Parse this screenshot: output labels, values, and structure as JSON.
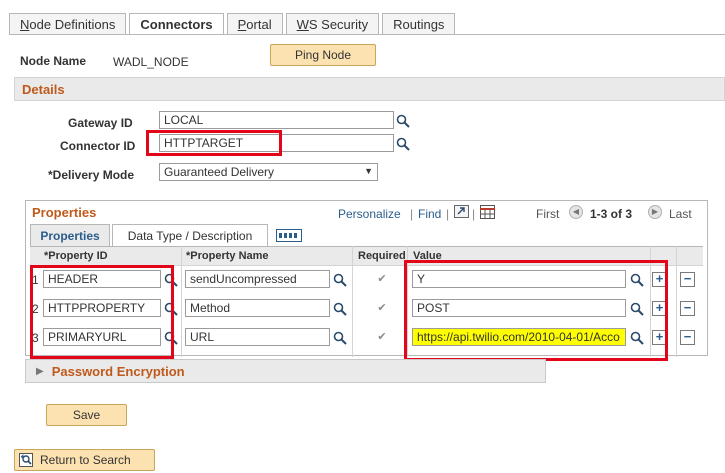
{
  "tabs": [
    {
      "label": "Node Definitions",
      "active": false
    },
    {
      "label": "Connectors",
      "active": true
    },
    {
      "label": "Portal",
      "active": false
    },
    {
      "label": "WS Security",
      "active": false
    },
    {
      "label": "Routings",
      "active": false
    }
  ],
  "node": {
    "label": "Node Name",
    "value": "WADL_NODE",
    "ping_label": "Ping Node"
  },
  "details": {
    "title": "Details",
    "gateway_label": "Gateway ID",
    "gateway_value": "LOCAL",
    "connector_label": "Connector ID",
    "connector_value": "HTTPTARGET",
    "delivery_label": "*Delivery Mode",
    "delivery_value": "Guaranteed Delivery"
  },
  "properties": {
    "title": "Properties",
    "personalize": "Personalize",
    "find": "Find",
    "first": "First",
    "range": "1-3 of 3",
    "last": "Last",
    "subtabs": [
      "Properties",
      "Data Type / Description"
    ],
    "columns": [
      "*Property ID",
      "*Property Name",
      "Required",
      "Value"
    ],
    "rows": [
      {
        "num": "1",
        "id": "HEADER",
        "name": "sendUncompressed",
        "required": true,
        "value": "Y"
      },
      {
        "num": "2",
        "id": "HTTPPROPERTY",
        "name": "Method",
        "required": true,
        "value": "POST"
      },
      {
        "num": "3",
        "id": "PRIMARYURL",
        "name": "URL",
        "required": true,
        "value": "https://api.twilio.com/2010-04-01/Acco"
      }
    ]
  },
  "password": {
    "title": "Password Encryption"
  },
  "save_label": "Save",
  "return_label": "Return to Search",
  "colors": {
    "section_title": "#c05a1c",
    "highlight_red": "#e3061a",
    "highlight_yellow": "#ffff00",
    "button_bg": "#fce2b0"
  }
}
